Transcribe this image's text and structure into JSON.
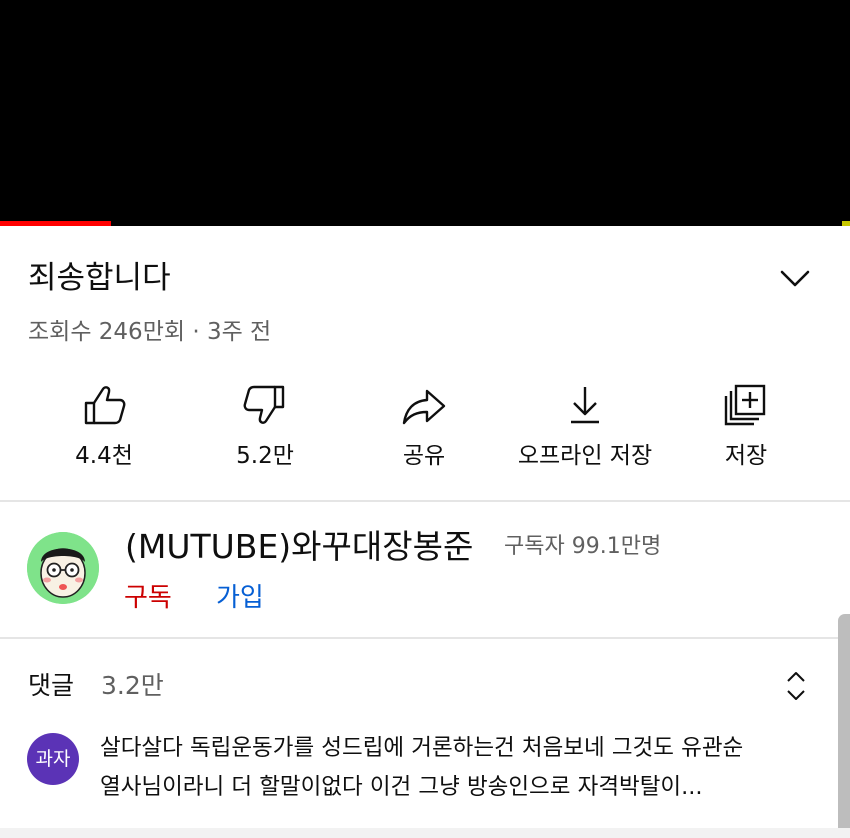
{
  "video": {
    "title": "죄송합니다",
    "meta": "조회수 246만회 · 3주 전",
    "progress_fraction": 0.13,
    "colors": {
      "progress": "#ff0000",
      "player": "#000000"
    }
  },
  "actions": {
    "like": {
      "label": "4.4천",
      "icon": "thumbs-up-icon"
    },
    "dislike": {
      "label": "5.2만",
      "icon": "thumbs-down-icon"
    },
    "share": {
      "label": "공유",
      "icon": "share-arrow-icon"
    },
    "download": {
      "label": "오프라인 저장",
      "icon": "download-icon"
    },
    "save": {
      "label": "저장",
      "icon": "add-to-playlist-icon"
    }
  },
  "channel": {
    "name": "(MUTUBE)와꾸대장봉준",
    "subscribers": "구독자 99.1만명",
    "subscribe_label": "구독",
    "join_label": "가입",
    "colors": {
      "subscribe": "#cc0000",
      "join": "#065fd4",
      "avatar_bg": "#7fe38a"
    }
  },
  "comments": {
    "label": "댓글",
    "count": "3.2만",
    "top_comment": {
      "avatar_text": "과자",
      "avatar_color": "#5b33b6",
      "text": "살다살다 독립운동가를 성드립에 거론하는건 처음보네 그것도 유관순 열사님이라니 더 할말이없다 이건 그냥 방송인으로 자격박탈이..."
    }
  }
}
